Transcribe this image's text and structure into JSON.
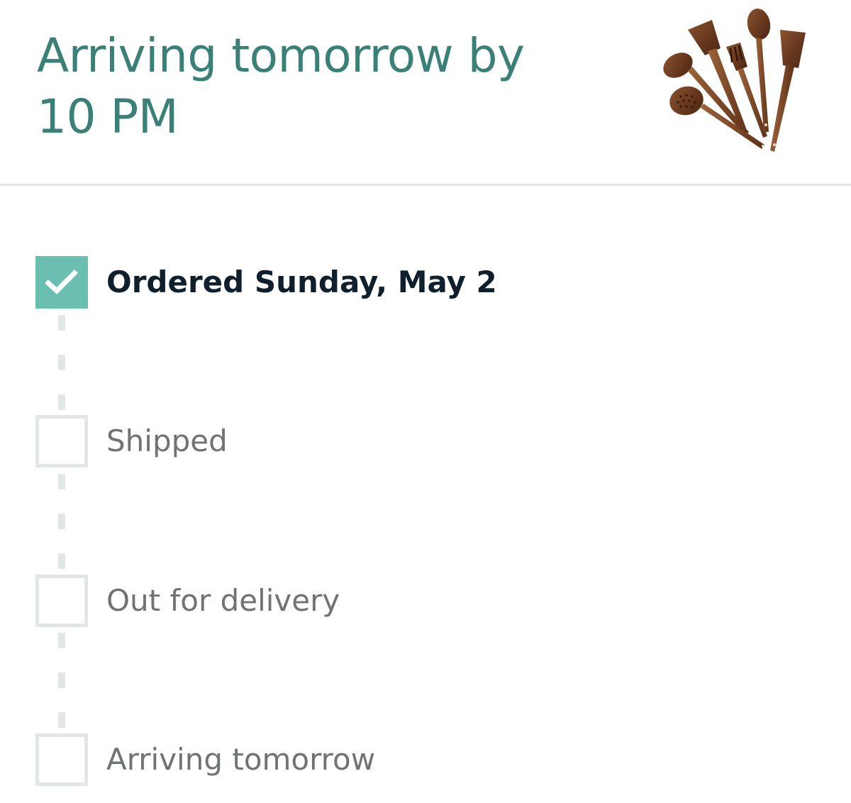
{
  "header": {
    "delivery_title": "Arriving tomorrow by 10 PM",
    "product_image_icon": "wooden-utensil-set-icon"
  },
  "tracker": {
    "steps": [
      {
        "label": "Ordered Sunday, May 2",
        "status": "completed",
        "icon": "check-icon"
      },
      {
        "label": "Shipped",
        "status": "pending",
        "icon": "empty-box-icon"
      },
      {
        "label": "Out for delivery",
        "status": "pending",
        "icon": "empty-box-icon"
      },
      {
        "label": "Arriving tomorrow",
        "status": "pending",
        "icon": "empty-box-icon"
      }
    ]
  },
  "colors": {
    "title_teal": "#3a8076",
    "completed_box": "#6bbfb1",
    "pending_border": "#e3e6e6",
    "completed_text": "#0f1f2b",
    "pending_text": "#6f7373",
    "divider": "#e3e6e6"
  }
}
